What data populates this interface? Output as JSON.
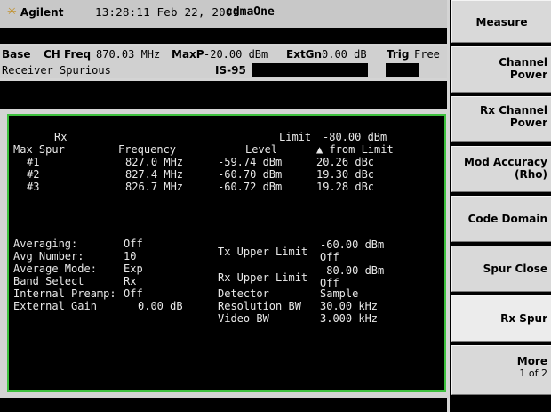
{
  "header": {
    "brand": "Agilent",
    "time": "13:28:11",
    "date": "Feb 22, 2001",
    "mode": "cdmaOne"
  },
  "status": {
    "line1_label": "Base",
    "ch_freq_label": "CH Freq",
    "ch_freq_value": "870.03 MHz",
    "maxp_label": "MaxP",
    "maxp_value": "-20.00 dBm",
    "extgn_label": "ExtGn",
    "extgn_value": "0.00 dB",
    "trig_label": "Trig",
    "trig_value": "Free",
    "measurement": "Receiver Spurious",
    "standard": "IS-95"
  },
  "results": {
    "col_rx": "Rx",
    "col_max_spur": "Max Spur",
    "col_frequency": "Frequency",
    "col_level": "Level",
    "limit_label": "Limit",
    "limit_value": "-80.00 dBm",
    "delta_label": "▲ from Limit",
    "rows": [
      {
        "id": "#1",
        "freq": "827.0 MHz",
        "level": "-59.74 dBm",
        "delta": "20.26 dBc"
      },
      {
        "id": "#2",
        "freq": "827.4 MHz",
        "level": "-60.70 dBm",
        "delta": "19.30 dBc"
      },
      {
        "id": "#3",
        "freq": "826.7 MHz",
        "level": "-60.72 dBm",
        "delta": "19.28 dBc"
      }
    ]
  },
  "settings": {
    "averaging_label": "Averaging:",
    "averaging_value": "Off",
    "avg_number_label": "Avg Number:",
    "avg_number_value": "10",
    "avg_mode_label": "Average Mode:",
    "avg_mode_value": "Exp",
    "band_select_label": "Band Select",
    "band_select_value": "Rx",
    "preamp_label": "Internal Preamp:",
    "preamp_value": "Off",
    "ext_gain_label": "External Gain",
    "ext_gain_value": "0.00 dB",
    "tx_upper_label": "Tx Upper Limit",
    "tx_upper_value": "-60.00 dBm",
    "tx_upper_state": "Off",
    "rx_upper_label": "Rx Upper Limit",
    "rx_upper_value": "-80.00 dBm",
    "rx_upper_state": "Off",
    "detector_label": "Detector",
    "detector_value": "Sample",
    "res_bw_label": "Resolution BW",
    "res_bw_value": "30.00 kHz",
    "video_bw_label": "Video BW",
    "video_bw_value": "3.000 kHz"
  },
  "softkeys": {
    "title": "Measure",
    "channel_power_1": "Channel",
    "channel_power_2": "Power",
    "rx_channel_power_1": "Rx Channel",
    "rx_channel_power_2": "Power",
    "mod_accuracy_1": "Mod Accuracy",
    "mod_accuracy_2": "(Rho)",
    "code_domain": "Code Domain",
    "spur_close": "Spur Close",
    "rx_spur": "Rx Spur",
    "more": "More",
    "more_page": "1 of 2"
  },
  "colors": {
    "frame": "#3ec03e",
    "display_bg": "#000000",
    "brand_icon": "#c08a18"
  }
}
